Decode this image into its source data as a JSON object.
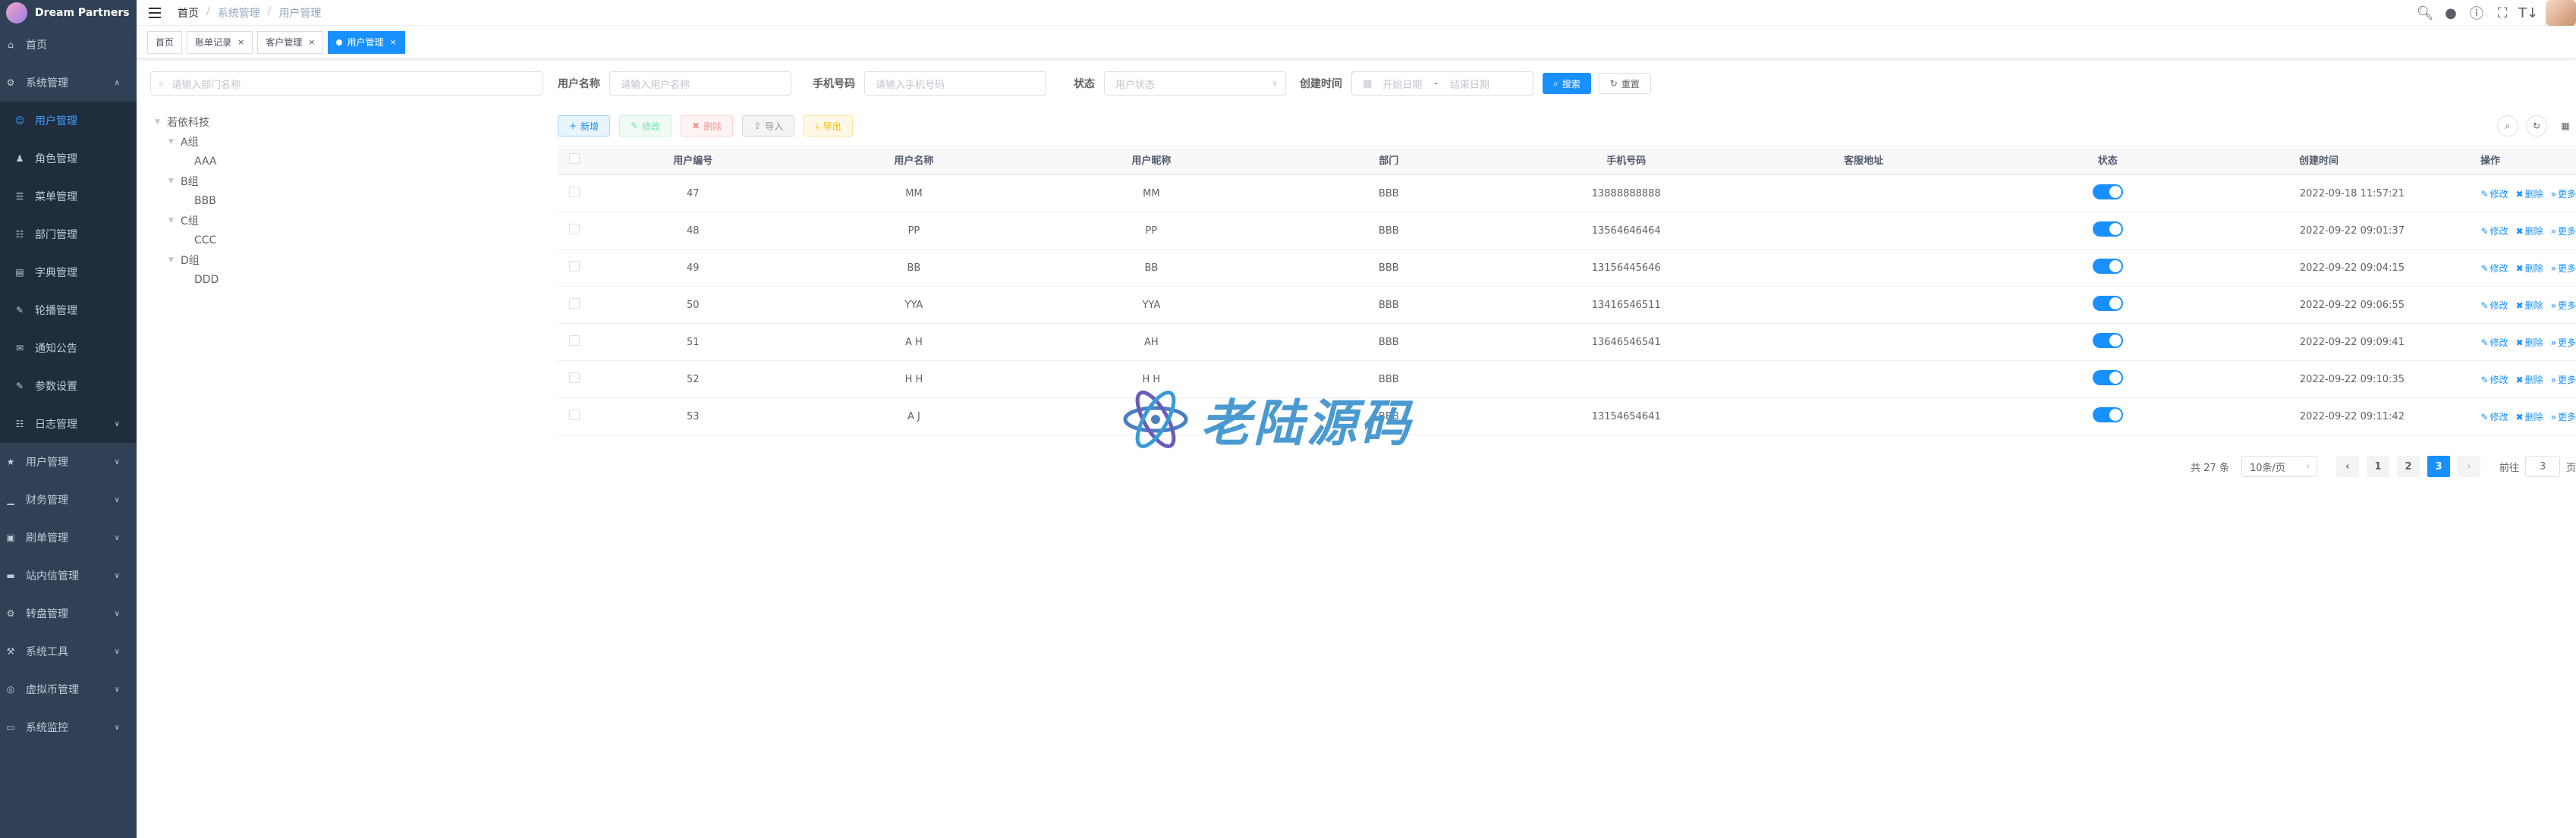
{
  "app": {
    "logo_text": "Dream Partners"
  },
  "sidebar": {
    "items": [
      {
        "label": "首页",
        "icon": "home-icon",
        "type": "top"
      },
      {
        "label": "系统管理",
        "icon": "gear-icon",
        "type": "top",
        "open": true
      },
      {
        "label": "用户管理",
        "icon": "user-icon",
        "type": "sub",
        "active": true
      },
      {
        "label": "角色管理",
        "icon": "role-icon",
        "type": "sub"
      },
      {
        "label": "菜单管理",
        "icon": "menu-icon",
        "type": "sub"
      },
      {
        "label": "部门管理",
        "icon": "tree-icon",
        "type": "sub"
      },
      {
        "label": "字典管理",
        "icon": "dict-icon",
        "type": "sub"
      },
      {
        "label": "轮播管理",
        "icon": "edit-icon",
        "type": "sub"
      },
      {
        "label": "通知公告",
        "icon": "message-icon",
        "type": "sub"
      },
      {
        "label": "参数设置",
        "icon": "edit-icon",
        "type": "sub"
      },
      {
        "label": "日志管理",
        "icon": "log-icon",
        "type": "sub",
        "arrow": true
      },
      {
        "label": "用户管理",
        "icon": "star-icon",
        "type": "top"
      },
      {
        "label": "财务管理",
        "icon": "chart-icon",
        "type": "top"
      },
      {
        "label": "刷单管理",
        "icon": "image-icon",
        "type": "top"
      },
      {
        "label": "站内信管理",
        "icon": "folder-icon",
        "type": "top"
      },
      {
        "label": "转盘管理",
        "icon": "settings-icon",
        "type": "top"
      },
      {
        "label": "系统工具",
        "icon": "tool-icon",
        "type": "top"
      },
      {
        "label": "虚拟币管理",
        "icon": "coin-icon",
        "type": "top"
      },
      {
        "label": "系统监控",
        "icon": "monitor-icon",
        "type": "top"
      }
    ]
  },
  "breadcrumb": {
    "home": "首页",
    "level1": "系统管理",
    "level2": "用户管理"
  },
  "tags": {
    "home": "首页",
    "t1": "账单记录",
    "t2": "客户管理",
    "t3": "用户管理"
  },
  "dept": {
    "search_placeholder": "请输入部门名称",
    "root": "若依科技",
    "groups": [
      {
        "name": "A组",
        "child": "AAA"
      },
      {
        "name": "B组",
        "child": "BBB"
      },
      {
        "name": "C组",
        "child": "CCC"
      },
      {
        "name": "D组",
        "child": "DDD"
      }
    ]
  },
  "form": {
    "username_label": "用户名称",
    "username_placeholder": "请输入用户名称",
    "phone_label": "手机号码",
    "phone_placeholder": "请输入手机号码",
    "status_label": "状态",
    "status_placeholder": "用户状态",
    "time_label": "创建时间",
    "start_placeholder": "开始日期",
    "range_sep": "-",
    "end_placeholder": "结束日期",
    "search_btn": "搜索",
    "reset_btn": "重置"
  },
  "toolbar": {
    "add": "新增",
    "edit": "修改",
    "delete": "删除",
    "import": "导入",
    "export": "导出"
  },
  "table": {
    "columns": [
      "用户编号",
      "用户名称",
      "用户昵称",
      "部门",
      "手机号码",
      "客服地址",
      "状态",
      "创建时间",
      "操作"
    ],
    "rows": [
      {
        "id": "47",
        "name": "MM",
        "nick": "MM",
        "dept": "BBB",
        "phone": "13888888888",
        "cs": "",
        "status": true,
        "time": "2022-09-18 11:57:21"
      },
      {
        "id": "48",
        "name": "PP",
        "nick": "PP",
        "dept": "BBB",
        "phone": "13564646464",
        "cs": "",
        "status": true,
        "time": "2022-09-22 09:01:37"
      },
      {
        "id": "49",
        "name": "BB",
        "nick": "BB",
        "dept": "BBB",
        "phone": "13156445646",
        "cs": "",
        "status": true,
        "time": "2022-09-22 09:04:15"
      },
      {
        "id": "50",
        "name": "YYA",
        "nick": "YYA",
        "dept": "BBB",
        "phone": "13416546511",
        "cs": "",
        "status": true,
        "time": "2022-09-22 09:06:55"
      },
      {
        "id": "51",
        "name": "A H",
        "nick": "AH",
        "dept": "BBB",
        "phone": "13646546541",
        "cs": "",
        "status": true,
        "time": "2022-09-22 09:09:41"
      },
      {
        "id": "52",
        "name": "H H",
        "nick": "H H",
        "dept": "BBB",
        "phone": "",
        "cs": "",
        "status": true,
        "time": "2022-09-22 09:10:35"
      },
      {
        "id": "53",
        "name": "A J",
        "nick": "",
        "dept": "BBB",
        "phone": "13154654641",
        "cs": "",
        "status": true,
        "time": "2022-09-22 09:11:42"
      }
    ],
    "ops": {
      "edit": "修改",
      "delete": "删除",
      "more": "更多"
    }
  },
  "pagination": {
    "total": "共 27 条",
    "page_size": "10条/页",
    "pages": [
      "1",
      "2",
      "3"
    ],
    "current": "3",
    "goto_label": "前往",
    "goto_value": "3",
    "page_suffix": "页"
  },
  "watermark": {
    "text": "老陆源码"
  },
  "colors": {
    "primary": "#1890ff",
    "sidebar": "#304156",
    "submenu": "#1f2d3d",
    "active_menu": "#409eff"
  }
}
